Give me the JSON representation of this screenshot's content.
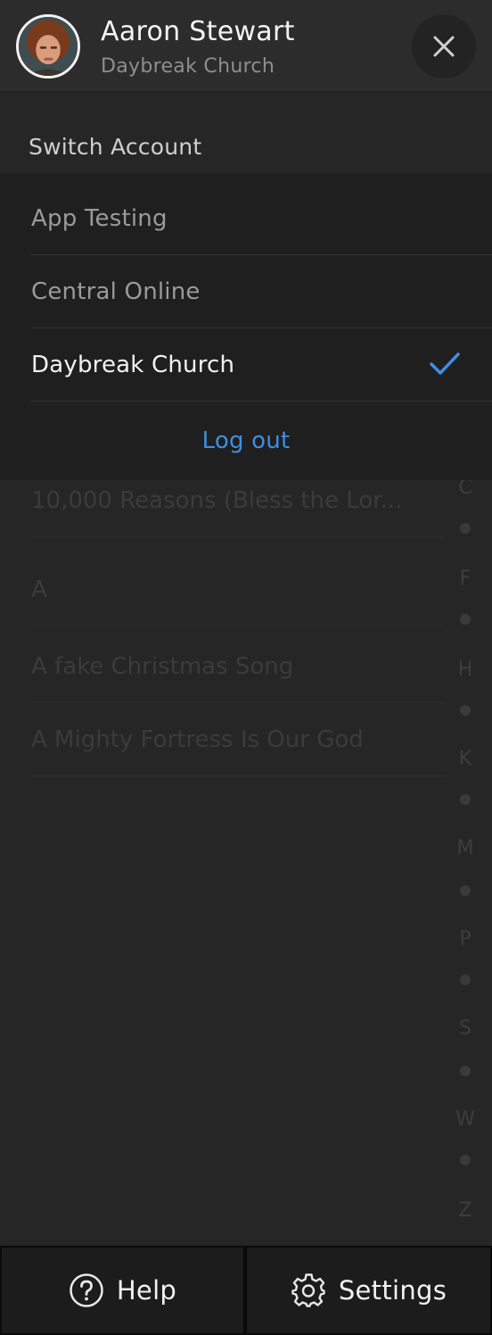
{
  "header": {
    "user_name": "Aaron Stewart",
    "organization": "Daybreak Church",
    "avatar_icon": "user-avatar-photo",
    "close_icon": "close-icon"
  },
  "switch_account": {
    "title": "Switch Account",
    "accounts": [
      {
        "label": "App Testing",
        "selected": false
      },
      {
        "label": "Central Online",
        "selected": false
      },
      {
        "label": "Daybreak Church",
        "selected": true
      }
    ],
    "logout_label": "Log out"
  },
  "song_list": {
    "items": [
      "10,000 Reasons (Bless the Lor...",
      "A",
      "A fake Christmas Song",
      "A Mighty Fortress Is Our God"
    ]
  },
  "alpha_index": [
    "C",
    "F",
    "H",
    "K",
    "M",
    "P",
    "S",
    "W",
    "Z"
  ],
  "footer": {
    "help_label": "Help",
    "settings_label": "Settings"
  },
  "colors": {
    "background": "#262626",
    "panel": "#1f1f1f",
    "accent": "#3d8fe0",
    "text_primary": "#f2f2f2",
    "text_muted": "#8e8e8e"
  }
}
